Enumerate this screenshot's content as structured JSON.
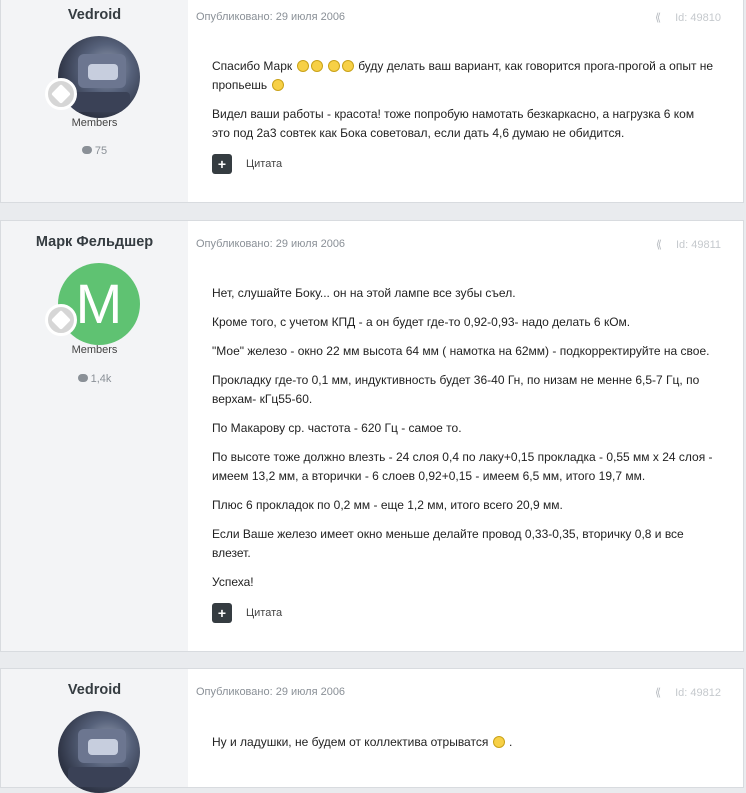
{
  "posts": [
    {
      "author": "Vedroid",
      "group": "Members",
      "post_count": "75",
      "avatar_type": "photo",
      "meta": "Опубликовано: 29 июля 2006",
      "post_id": "Id: 49810",
      "paragraphs": [
        "Спасибо Марк",
        "буду делать ваш вариант, как говорится прога-прогой а опыт не пропьешь",
        "Видел ваши работы - красота! тоже попробую намотать безкаркасно, а нагрузка 6 ком это под 2а3 совтек как Бока советовал, если дать 4,6 думаю не обидится."
      ],
      "quote_label": "Цитата"
    },
    {
      "author": "Марк Фельдшер",
      "group": "Members",
      "post_count": "1,4k",
      "avatar_type": "letter",
      "avatar_letter": "M",
      "meta": "Опубликовано: 29 июля 2006",
      "post_id": "Id: 49811",
      "paragraphs": [
        "Нет, слушайте Боку... он на этой лампе все зубы съел.",
        "Кроме того, с учетом КПД - а он будет где-то 0,92-0,93- надо делать 6 кОм.",
        "\"Мое\" железо - окно 22 мм высота 64 мм ( намотка на 62мм) - подкорректируйте на свое.",
        "Прокладку где-то 0,1 мм, индуктивность будет 36-40 Гн, по низам не менне 6,5-7 Гц, по верхам- кГц55-60.",
        "По Макарову ср. частота - 620 Гц - самое то.",
        "По высоте тоже должно влезть - 24 слоя 0,4 по лаку+0,15 прокладка - 0,55 мм х 24 слоя - имеем 13,2 мм, а вторички - 6 слоев 0,92+0,15 - имеем 6,5 мм, итого 19,7 мм.",
        "Плюс 6 прокладок по 0,2 мм - еще 1,2 мм, итого всего 20,9 мм.",
        "Если Ваше железо имеет окно меньше делайте провод 0,33-0,35, вторичку 0,8 и все влезет.",
        "Успеха!"
      ],
      "quote_label": "Цитата"
    },
    {
      "author": "Vedroid",
      "avatar_type": "photo",
      "meta": "Опубликовано: 29 июля 2006",
      "post_id": "Id: 49812",
      "paragraphs": [
        "Ну и ладушки, не будем от коллектива отрыватся",
        "."
      ]
    }
  ],
  "icons": {
    "share": "share-icon",
    "quote": "plus-icon",
    "post_count": "speech-bubble-icon",
    "rank": "rank-badge-icon"
  },
  "colors": {
    "author_panel": "#f3f4f6",
    "avatar_letter_bg": "#5fc272",
    "quote_button": "#353c41"
  }
}
